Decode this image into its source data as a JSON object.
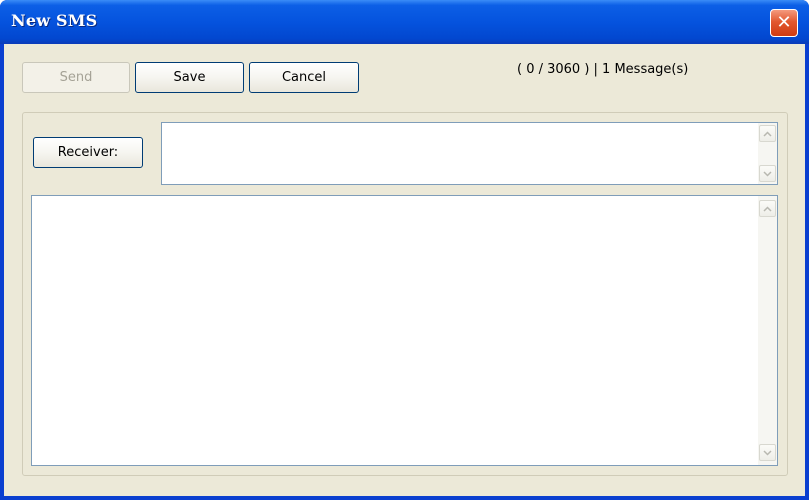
{
  "window": {
    "title": "New SMS",
    "close_glyph": "✕"
  },
  "toolbar": {
    "send_label": "Send",
    "save_label": "Save",
    "cancel_label": "Cancel"
  },
  "status": {
    "text": "( 0 / 3060 ) | 1 Message(s)"
  },
  "receiver": {
    "button_label": "Receiver:",
    "value": ""
  },
  "message": {
    "value": ""
  },
  "icons": {
    "close": "close-icon",
    "scroll_up": "chevron-up-icon",
    "scroll_down": "chevron-down-icon"
  },
  "colors": {
    "titlebar": "#0553de",
    "client_bg": "#ece9d8",
    "close_button": "#e2582f",
    "button_border": "#003c74"
  }
}
